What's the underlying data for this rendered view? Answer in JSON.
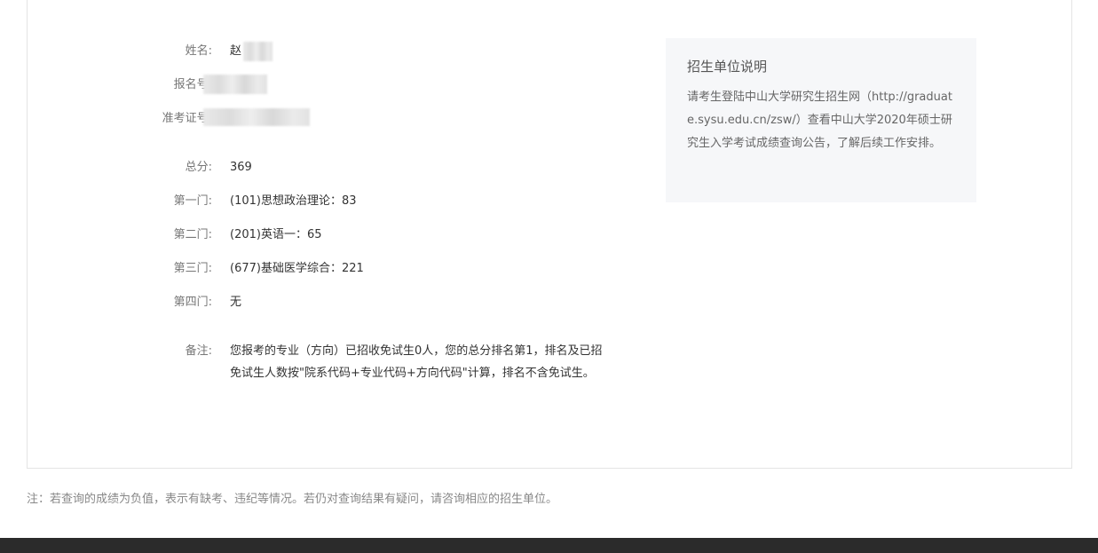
{
  "fields": {
    "name_label": "姓名:",
    "name_value_visible": "赵",
    "reg_no_label": "报名号:",
    "exam_no_label": "准考证号:",
    "total_label": "总分:",
    "total_value": "369",
    "subject1_label": "第一门:",
    "subject1_value": "(101)思想政治理论：83",
    "subject2_label": "第二门:",
    "subject2_value": "(201)英语一：65",
    "subject3_label": "第三门:",
    "subject3_value": "(677)基础医学综合：221",
    "subject4_label": "第四门:",
    "subject4_value": "无",
    "remark_label": "备注:",
    "remark_value": "您报考的专业（方向）已招收免试生0人，您的总分排名第1，排名及已招免试生人数按\"院系代码+专业代码+方向代码\"计算，排名不含免试生。"
  },
  "side_panel": {
    "title": "招生单位说明",
    "text": "请考生登陆中山大学研究生招生网（http://graduate.sysu.edu.cn/zsw/）查看中山大学2020年硕士研究生入学考试成绩查询公告，了解后续工作安排。"
  },
  "footnote": "注：若查询的成绩为负值，表示有缺考、违纪等情况。若仍对查询结果有疑问，请咨询相应的招生单位。",
  "colors": {
    "label": "#777777",
    "value": "#333333",
    "side_bg": "#f6f7f9",
    "footer_bar": "#2b2b2b"
  }
}
